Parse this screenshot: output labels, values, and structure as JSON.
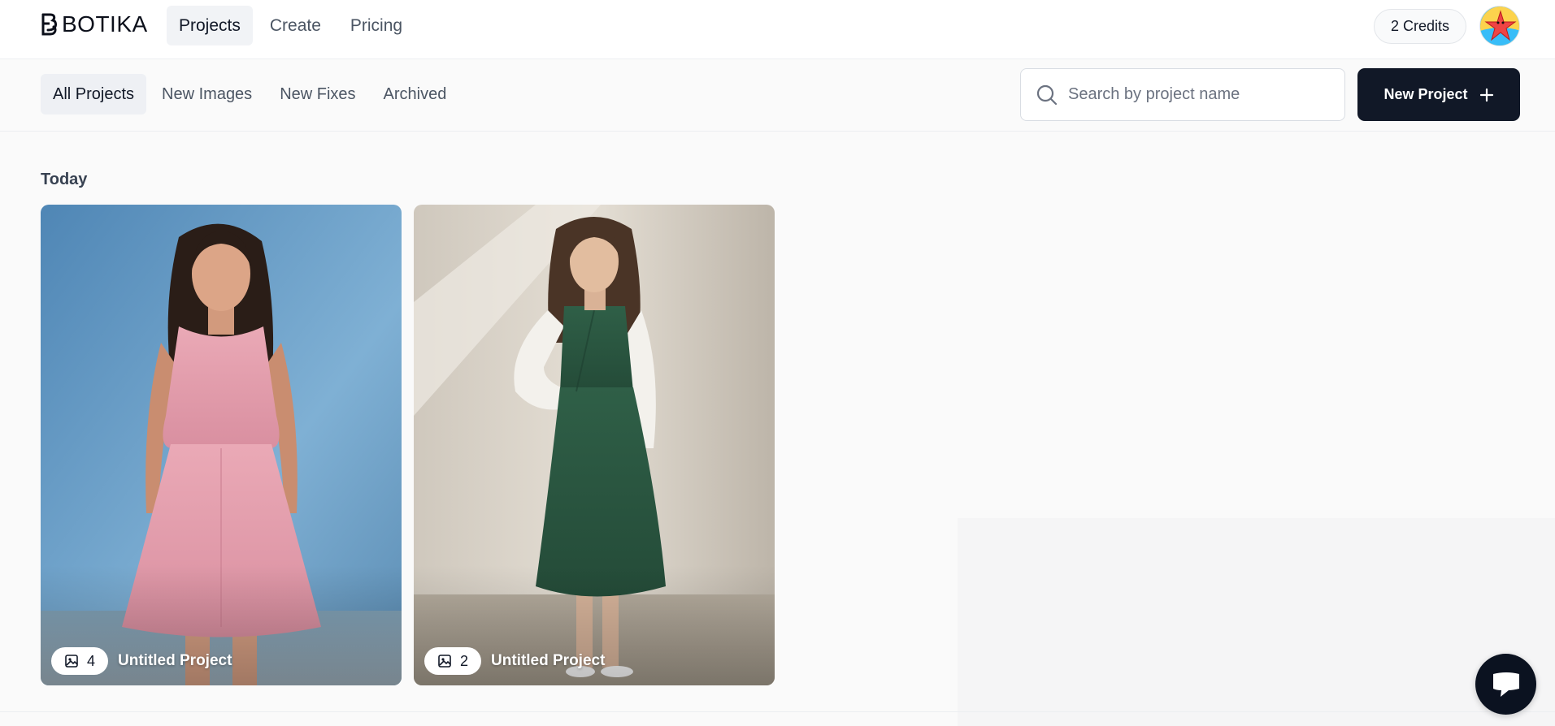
{
  "brand": {
    "name": "BOTIKA"
  },
  "nav": {
    "items": [
      {
        "label": "Projects",
        "active": true
      },
      {
        "label": "Create",
        "active": false
      },
      {
        "label": "Pricing",
        "active": false
      }
    ]
  },
  "account": {
    "credits": "2 Credits",
    "avatar_icon": "starfish-avatar"
  },
  "filters": {
    "tabs": [
      {
        "label": "All Projects",
        "active": true
      },
      {
        "label": "New Images",
        "active": false
      },
      {
        "label": "New Fixes",
        "active": false
      },
      {
        "label": "Archived",
        "active": false
      }
    ]
  },
  "search": {
    "placeholder": "Search by project name",
    "value": ""
  },
  "actions": {
    "new_project_label": "New Project"
  },
  "section": {
    "title": "Today"
  },
  "projects": [
    {
      "title": "Untitled Project",
      "image_count": "4",
      "dress": "pink sleeveless dress",
      "dress_color": "#e79fae",
      "background": "#6f9fc4"
    },
    {
      "title": "Untitled Project",
      "image_count": "2",
      "dress": "green wrap dress with white cardigan",
      "dress_color": "#2c5a43",
      "background": "#d9d3c8"
    }
  ],
  "colors": {
    "primary": "#111827",
    "accent_bg": "#f1f3f6",
    "page_bg": "#fafafa"
  }
}
